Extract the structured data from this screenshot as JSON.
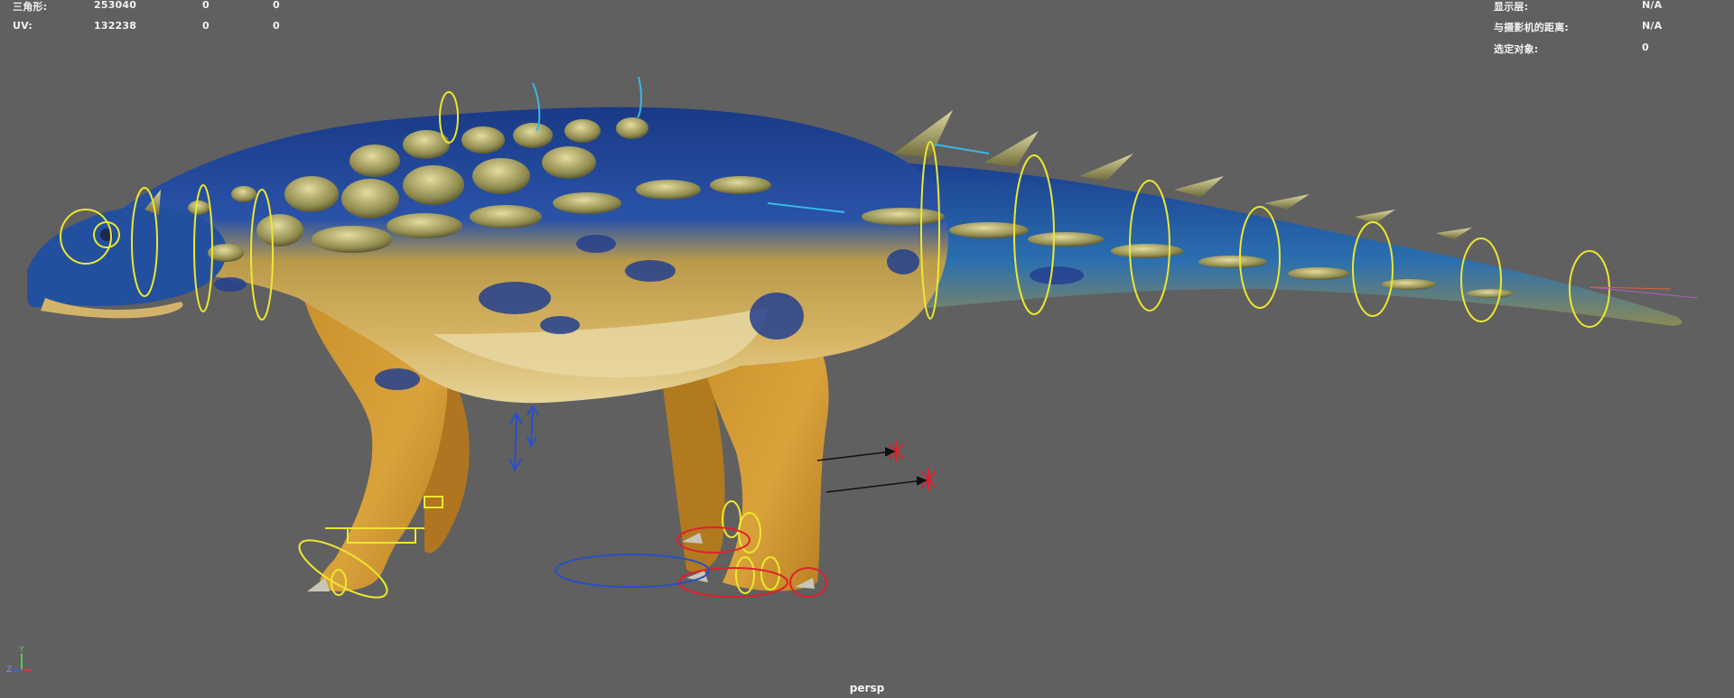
{
  "hud_left": {
    "rows": [
      {
        "label": "三角形:",
        "v1": "253040",
        "v2": "0",
        "v3": "0"
      },
      {
        "label": "UV:",
        "v1": "132238",
        "v2": "0",
        "v3": "0"
      }
    ]
  },
  "hud_right": {
    "rows": [
      {
        "label": "显示层:",
        "value": "N/A"
      },
      {
        "label": "与摄影机的距离:",
        "value": "N/A"
      },
      {
        "label": "选定对象:",
        "value": "0"
      }
    ]
  },
  "viewport": {
    "camera": "persp",
    "background_color": "#606060"
  },
  "axis": {
    "y_label": "Y",
    "z_label": "Z",
    "x_color": "#d23b3b",
    "y_color": "#58c85a",
    "z_color": "#3f62d6"
  },
  "colors": {
    "control_yellow": "#ece72f",
    "control_red": "#e11f2d",
    "control_cyan": "#39b8e6",
    "control_blue": "#2950c8",
    "skin_blue": "#1e3f8d",
    "skin_yellow": "#d2a036",
    "spike_green": "#a8a466"
  }
}
